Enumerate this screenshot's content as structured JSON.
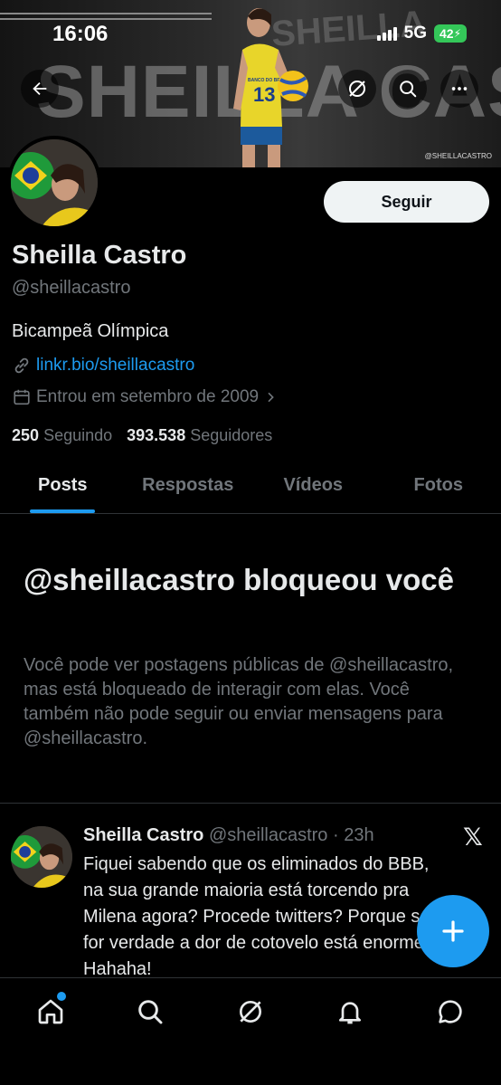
{
  "status_bar": {
    "time": "16:06",
    "network": "5G",
    "battery": "42"
  },
  "banner": {
    "text": "SHEILLA CASTRO",
    "name_overlay": "SHEILLA",
    "jersey_number": "13",
    "jersey_sponsor": "BANCO DO BRASIL",
    "instagram_tag": "@SHEILLACASTRO"
  },
  "header": {
    "back_icon": "arrow-left-icon",
    "grok_icon": "slash-circle-icon",
    "search_icon": "search-icon",
    "more_icon": "more-dots-icon"
  },
  "profile": {
    "follow_label": "Seguir",
    "display_name": "Sheilla Castro",
    "handle": "@sheillacastro",
    "bio": "Bicampeã Olímpica",
    "link": "linkr.bio/sheillacastro",
    "joined": "Entrou em setembro de 2009",
    "following_count": "250",
    "following_label": "Seguindo",
    "followers_count": "393.538",
    "followers_label": "Seguidores"
  },
  "tabs": [
    {
      "label": "Posts",
      "active": true
    },
    {
      "label": "Respostas",
      "active": false
    },
    {
      "label": "Vídeos",
      "active": false
    },
    {
      "label": "Fotos",
      "active": false
    }
  ],
  "blocked": {
    "title": "@sheillacastro bloqueou você",
    "text": "Você pode ver postagens públicas de @sheillacastro, mas está bloqueado de interagir com elas. Você também não pode seguir ou enviar mensagens para @sheillacastro."
  },
  "tweet": {
    "author": "Sheilla Castro",
    "handle": "@sheillacastro",
    "time": "23h",
    "text": "Fiquei sabendo que os eliminados do BBB,\nna sua grande maioria está torcendo pra\nMilena agora? Procede twitters? Porque se\nfor verdade a dor de cotovelo está enorme\nHahaha!"
  },
  "colors": {
    "accent": "#1d9bf0",
    "battery": "#34c759",
    "muted": "#71767b"
  },
  "bottom_nav": [
    "home-icon",
    "search-icon",
    "grok-icon",
    "notifications-icon",
    "messages-icon"
  ]
}
